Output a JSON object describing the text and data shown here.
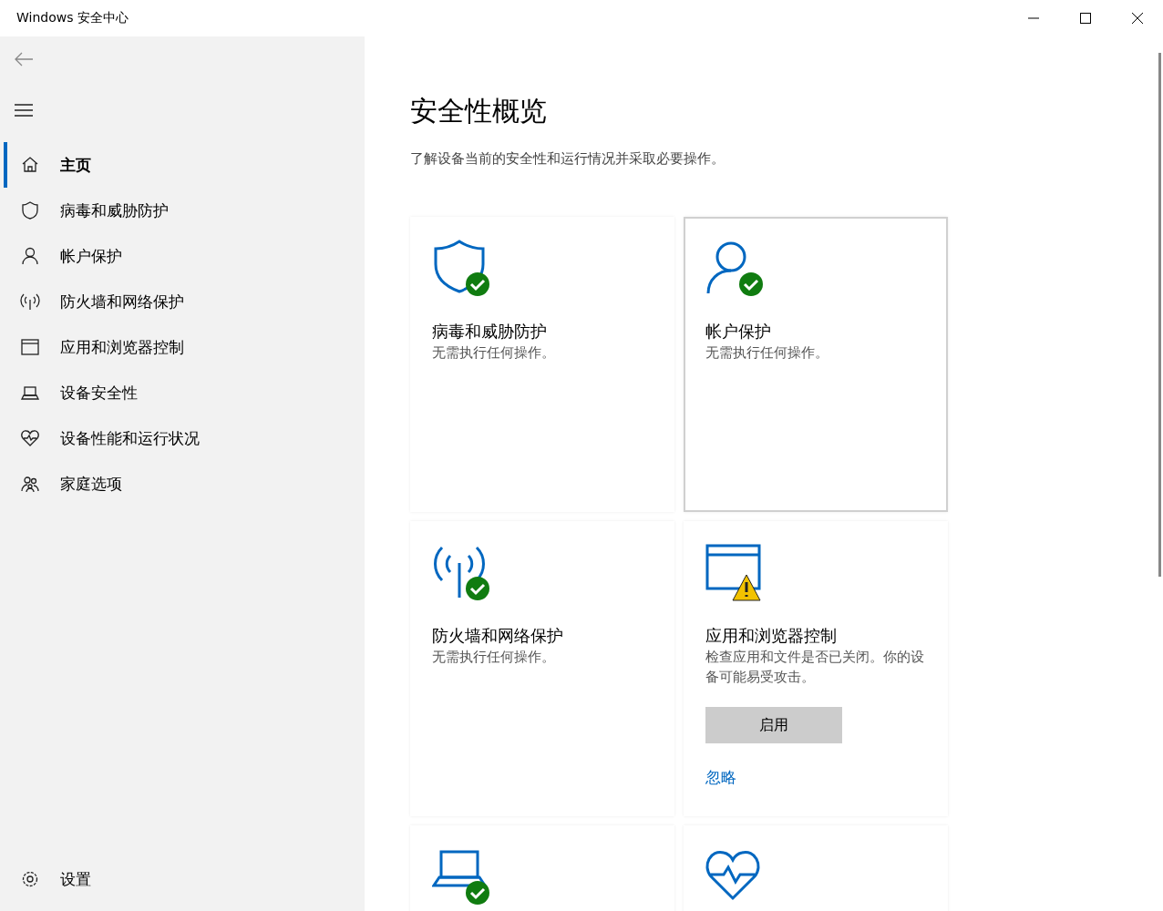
{
  "window": {
    "title": "Windows 安全中心"
  },
  "sidebar": {
    "items": [
      {
        "label": "主页",
        "selected": true
      },
      {
        "label": "病毒和威胁防护",
        "selected": false
      },
      {
        "label": "帐户保护",
        "selected": false
      },
      {
        "label": "防火墙和网络保护",
        "selected": false
      },
      {
        "label": "应用和浏览器控制",
        "selected": false
      },
      {
        "label": "设备安全性",
        "selected": false
      },
      {
        "label": "设备性能和运行状况",
        "selected": false
      },
      {
        "label": "家庭选项",
        "selected": false
      }
    ],
    "settings": {
      "label": "设置"
    }
  },
  "main": {
    "title": "安全性概览",
    "subtitle": "了解设备当前的安全性和运行情况并采取必要操作。",
    "cards": [
      {
        "kind": "ok",
        "highlighted": false,
        "title": "病毒和威胁防护",
        "detail": "无需执行任何操作。"
      },
      {
        "kind": "ok",
        "highlighted": true,
        "title": "帐户保护",
        "detail": "无需执行任何操作。"
      },
      {
        "kind": "ok",
        "highlighted": false,
        "title": "防火墙和网络保护",
        "detail": "无需执行任何操作。"
      },
      {
        "kind": "warning",
        "highlighted": false,
        "title": "应用和浏览器控制",
        "detail": "检查应用和文件是否已关闭。你的设备可能易受攻击。",
        "button": "启用",
        "link": "忽略"
      },
      {
        "kind": "ok",
        "highlighted": false
      },
      {
        "kind": "plain",
        "highlighted": false
      }
    ]
  }
}
